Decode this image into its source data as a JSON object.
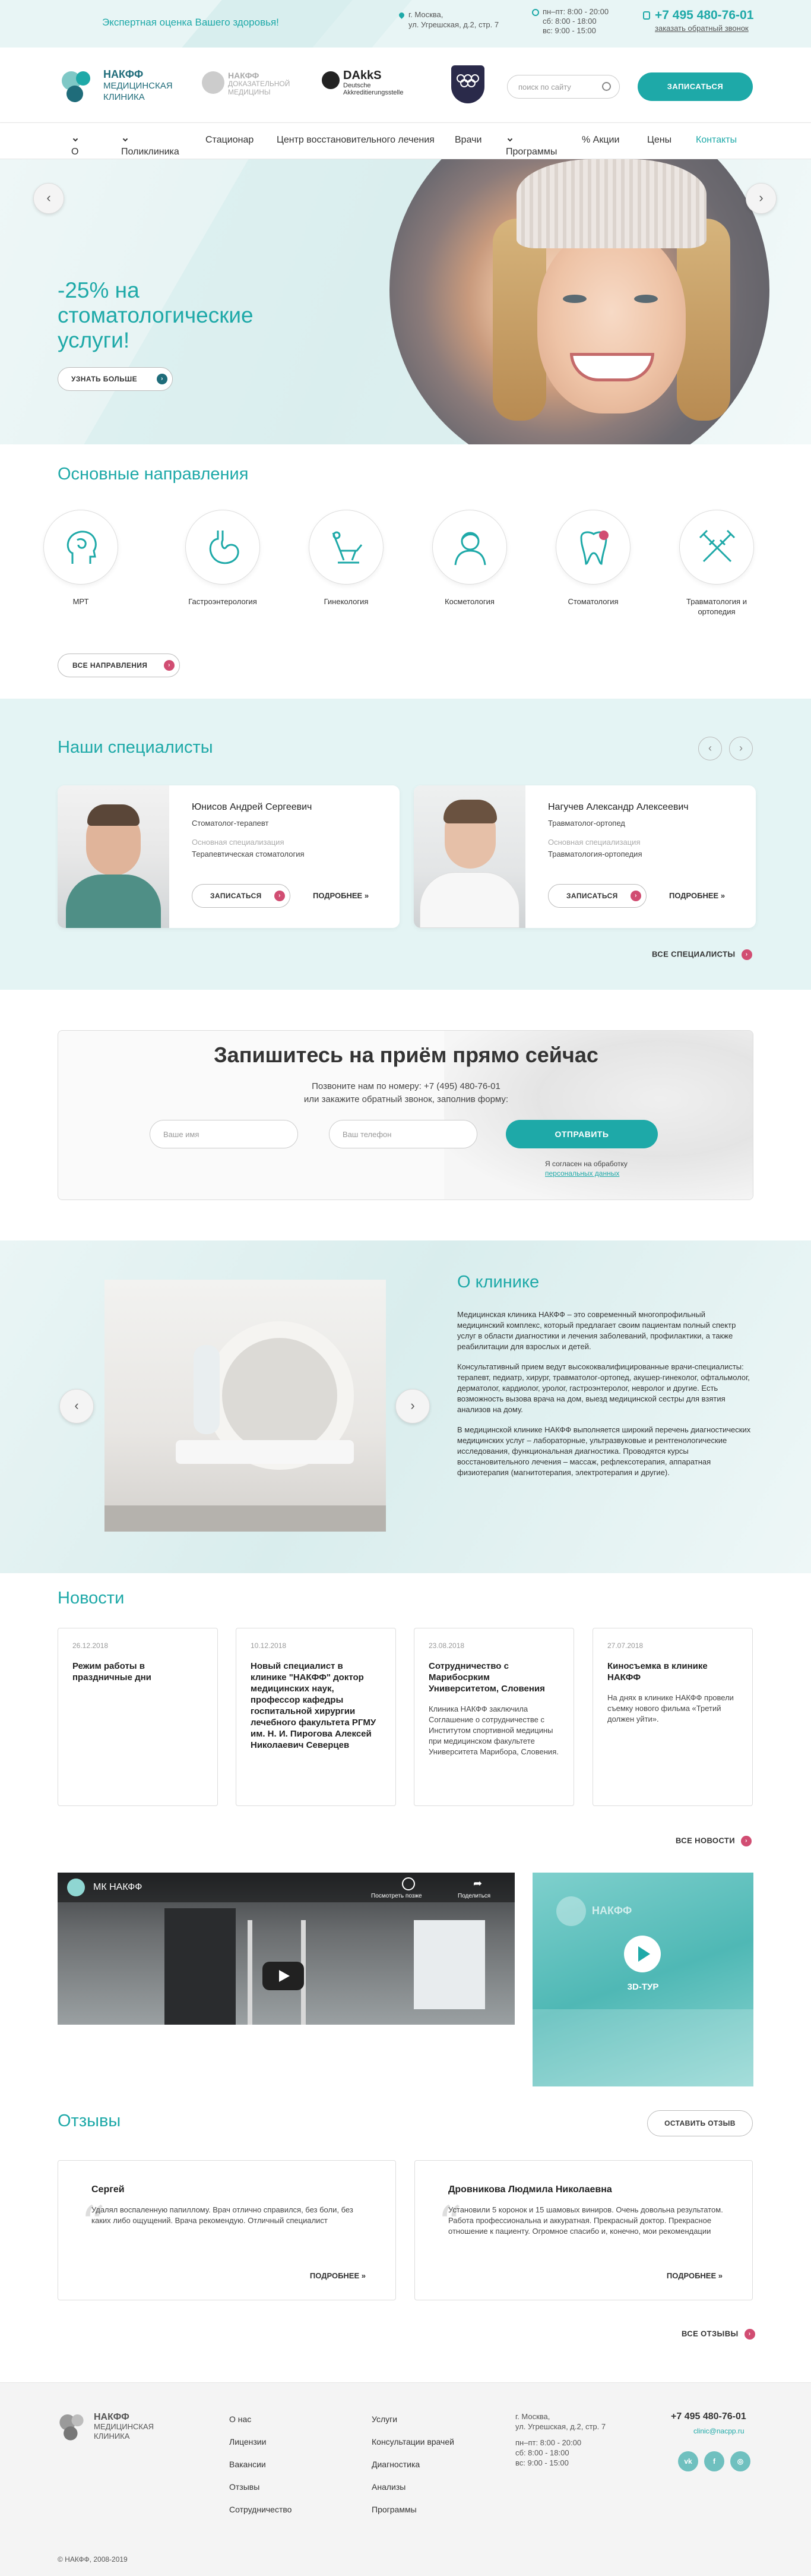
{
  "topbar": {
    "slogan": "Экспертная оценка Вашего здоровья!",
    "address_line1": "г. Москва,",
    "address_line2": "ул. Угрешская, д.2, стр. 7",
    "hours_line1": "пн–пт: 8:00 - 20:00",
    "hours_line2": "сб: 8:00 - 18:00",
    "hours_line3": "вс: 9:00 - 15:00",
    "phone": "+7 495 480-76-01",
    "callback": "заказать обратный звонок"
  },
  "header": {
    "logo_line1": "НАКФФ",
    "logo_line2": "МЕДИЦИНСКАЯ",
    "logo_line3": "КЛИНИКА",
    "partner1_line1": "НАКФФ",
    "partner1_line2": "ДОКАЗАТЕЛЬНОЙ",
    "partner1_line3": "МЕДИЦИНЫ",
    "dakks_title": "DAkkS",
    "dakks_text": "Deutsche Akkreditierungsstelle",
    "search_placeholder": "поиск по сайту",
    "signup_button": "ЗАПИСАТЬСЯ"
  },
  "nav": {
    "items": [
      "О нас",
      "Поликлиника",
      "Стационар",
      "Центр восстановительного лечения",
      "Врачи",
      "Программы",
      "% Акции",
      "Цены",
      "Контакты"
    ]
  },
  "hero": {
    "title_line1": "-25% на",
    "title_line2": "стоматологические",
    "title_line3": "услуги!",
    "button": "УЗНАТЬ БОЛЬШЕ",
    "prev": "‹",
    "next": "›"
  },
  "directions": {
    "title": "Основные направления",
    "items": [
      "МРТ",
      "Гастроэнтерология",
      "Гинекология",
      "Косметология",
      "Стоматология",
      "Травматология и ортопедия"
    ],
    "all_button": "ВСЕ НАПРАВЛЕНИЯ"
  },
  "specialists": {
    "title": "Наши специалисты",
    "cards": [
      {
        "name": "Юнисов Андрей Сергеевич",
        "role": "Стоматолог-терапевт",
        "main_label": "Основная специализация",
        "main_value": "Терапевтическая стоматология",
        "signup": "ЗАПИСАТЬСЯ",
        "more": "ПОДРОБНЕЕ »"
      },
      {
        "name": "Нагучев Александр Алексеевич",
        "role": "Травматолог-ортопед",
        "main_label": "Основная специализация",
        "main_value": "Травматология-ортопедия",
        "signup": "ЗАПИСАТЬСЯ",
        "more": "ПОДРОБНЕЕ »"
      }
    ],
    "all_link": "ВСЕ СПЕЦИАЛИСТЫ"
  },
  "booking": {
    "title": "Запишитесь на приём прямо сейчас",
    "sub1": "Позвоните нам по номеру: +7 (495) 480-76-01",
    "sub2": "или закажите обратный звонок, заполнив форму:",
    "name_placeholder": "Ваше имя",
    "phone_placeholder": "Ваш телефон",
    "submit": "ОТПРАВИТЬ",
    "agree1": "Я согласен на обработку",
    "agree2": "персональных данных"
  },
  "about": {
    "title": "О клинике",
    "p1": "Медицинская клиника НАКФФ – это современный многопрофильный медицинский комплекс, который предлагает своим пациентам полный спектр услуг в области диагностики и лечения заболеваний, профилактики, а также реабилитации для взрослых и детей.",
    "p2": "Консультативный прием ведут высококвалифицированные врачи-специалисты: терапевт, педиатр, хирург, травматолог-ортопед, акушер-гинеколог, офтальмолог, дерматолог, кардиолог, уролог, гастроэнтеролог, невролог и другие. Есть возможность вызова врача на дом, выезд медицинской сестры для взятия анализов на дому.",
    "p3": "В медицинской клинике НАКФФ выполняется широкий перечень диагностических медицинских услуг – лабораторные, ультразвуковые и рентгенологические исследования, функциональная диагностика. Проводятся курсы восстановительного лечения – массаж, рефлексотерапия, аппаратная физиотерапия (магнитотерапия, электротерапия и другие)."
  },
  "news": {
    "title": "Новости",
    "items": [
      {
        "date": "26.12.2018",
        "title": "Режим работы в праздничные дни",
        "text": ""
      },
      {
        "date": "10.12.2018",
        "title": "Новый специалист в клинике \"НАКФФ\" доктор медицинских наук, профессор кафедры госпитальной хирургии лечебного факультета РГМУ им. Н. И. Пирогова Алексей Николаевич Северцев",
        "text": ""
      },
      {
        "date": "23.08.2018",
        "title": "Сотрудничество с Марибосрким Университетом, Словения",
        "text": "Клиника НАКФФ заключила Соглашение о сотрудничестве с Институтом спортивной медицины при медицинском факультете Университета Марибора, Словения."
      },
      {
        "date": "27.07.2018",
        "title": "Киносъемка в клинике НАКФФ",
        "text": "На днях в клинике НАКФФ провели съемку нового фильма «Третий должен уйти»."
      }
    ],
    "all_link": "ВСЕ НОВОСТИ"
  },
  "media": {
    "video_title": "МК НАКФФ",
    "watch_later": "Посмотреть позже",
    "share": "Поделиться",
    "tour_label": "3D-ТУР",
    "tour_brand": "НАКФФ"
  },
  "reviews": {
    "title": "Отзывы",
    "leave_button": "ОСТАВИТЬ ОТЗЫВ",
    "items": [
      {
        "name": "Сергей",
        "text": "Удалял воспаленную папиллому. Врач отлично справился, без боли, без каких либо ощущений. Врача рекомендую. Отличный специалист",
        "more": "ПОДРОБНЕЕ »"
      },
      {
        "name": "Дровникова Людмила Николаевна",
        "text": "Установили 5 коронок и 15 шамовых виниров. Очень довольна результатом. Работа профессиональна и аккуратная. Прекрасный доктор. Прекрасное отношение к пациенту. Огромное спасибо и, конечно, мои рекомендации",
        "more": "ПОДРОБНЕЕ »"
      }
    ],
    "all_link": "ВСЕ ОТЗЫВЫ"
  },
  "footer": {
    "col1": [
      "О нас",
      "Лицензии",
      "Вакансии",
      "Отзывы",
      "Сотрудничество"
    ],
    "col2": [
      "Услуги",
      "Консультации врачей",
      "Диагностика",
      "Анализы",
      "Программы"
    ],
    "address_line1": "г. Москва,",
    "address_line2": "ул. Угрешская, д.2, стр. 7",
    "hours_line1": "пн–пт: 8:00 - 20:00",
    "hours_line2": "сб: 8:00 - 18:00",
    "hours_line3": "вс: 9:00 - 15:00",
    "phone": "+7 495 480-76-01",
    "email": "clinic@nacpp.ru",
    "social": [
      "vk-icon",
      "facebook-icon",
      "instagram-icon"
    ],
    "copyright": "© НАКФФ, 2008-2019"
  },
  "colors": {
    "accent": "#1ea9a8",
    "accent_light": "#e4f4f4",
    "dot": "#d14d72"
  }
}
